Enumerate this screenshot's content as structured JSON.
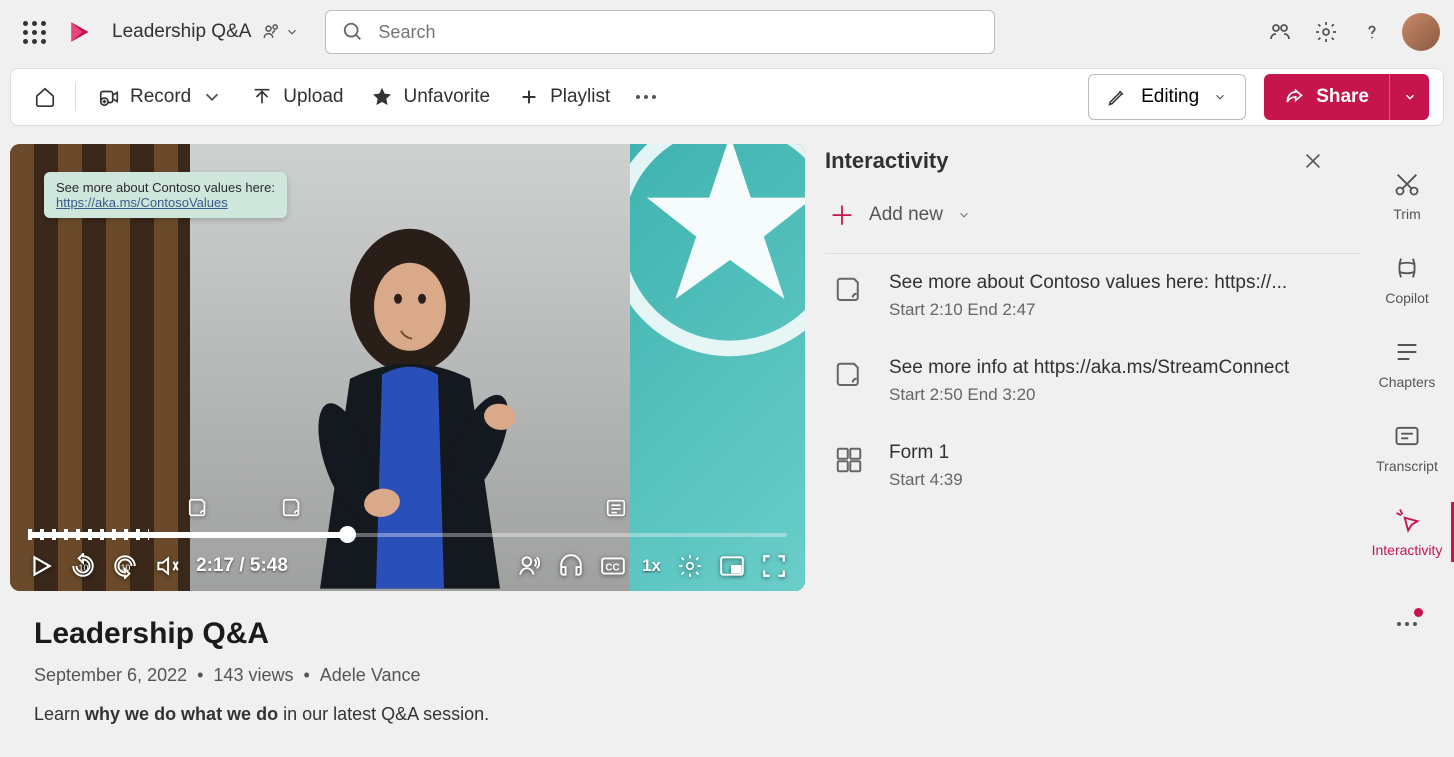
{
  "topbar": {
    "title": "Leadership Q&A",
    "search_placeholder": "Search"
  },
  "toolbar": {
    "record": "Record",
    "upload": "Upload",
    "unfavorite": "Unfavorite",
    "playlist": "Playlist",
    "editing": "Editing",
    "share": "Share"
  },
  "video": {
    "popup_text": "See more about Contoso values here:",
    "popup_link": "https://aka.ms/ContosoValues",
    "current_time": "2:17",
    "duration": "5:48",
    "speed": "1x"
  },
  "info": {
    "title": "Leadership Q&A",
    "date": "September 6, 2022",
    "views": "143 views",
    "owner": "Adele Vance",
    "desc_plain1": "Learn ",
    "desc_bold": "why we do what we do",
    "desc_plain2": " in our latest Q&A session."
  },
  "panel": {
    "title": "Interactivity",
    "add_new": "Add new",
    "items": [
      {
        "title": "See more about Contoso values here: https://...",
        "meta": "Start 2:10 End 2:47",
        "icon": "note"
      },
      {
        "title": "See more info at https://aka.ms/StreamConnect",
        "meta": "Start 2:50 End 3:20",
        "icon": "note"
      },
      {
        "title": "Form 1",
        "meta": "Start 4:39",
        "icon": "form"
      }
    ]
  },
  "sidetabs": {
    "trim": "Trim",
    "copilot": "Copilot",
    "chapters": "Chapters",
    "transcript": "Transcript",
    "interactivity": "Interactivity"
  }
}
